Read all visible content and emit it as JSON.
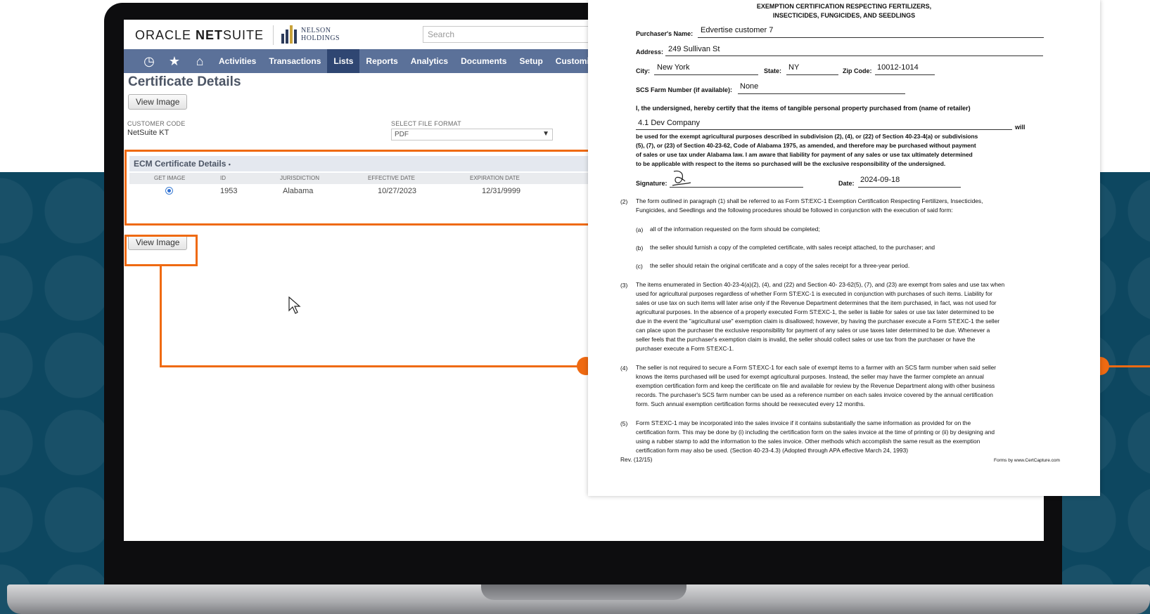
{
  "colors": {
    "accent_orange": "#ef6a12",
    "nav_bg": "#5b7199",
    "nav_active": "#2f4672",
    "backdrop": "#0d4760"
  },
  "app": {
    "logo_oracle": "ORACLE",
    "logo_netsuite_bold": "NET",
    "logo_netsuite_rest": "SUITE",
    "logo_partner_line1": "NELSON",
    "logo_partner_line2": "HOLDINGS",
    "search_placeholder": "Search"
  },
  "nav": {
    "icons": [
      "history-icon",
      "star-icon",
      "home-icon"
    ],
    "items": [
      "Activities",
      "Transactions",
      "Lists",
      "Reports",
      "Analytics",
      "Documents",
      "Setup",
      "Customi"
    ],
    "active": "Lists"
  },
  "page": {
    "title": "Certificate Details",
    "view_image_top": "View Image",
    "customer_code_label": "CUSTOMER CODE",
    "customer_code_value": "NetSuite KT",
    "file_format_label": "SELECT FILE FORMAT",
    "file_format_value": "PDF",
    "sublist_title": "ECM Certificate Details",
    "sublist_marker": "•",
    "columns": [
      "GET IMAGE",
      "ID",
      "JURISDICTION",
      "EFFECTIVE DATE",
      "EXPIRATION DATE"
    ],
    "row": {
      "id": "1953",
      "jurisdiction": "Alabama",
      "effective_date": "10/27/2023",
      "expiration_date": "12/31/9999"
    },
    "view_image_bottom": "View Image"
  },
  "document": {
    "title_line1": "EXEMPTION CERTIFICATION RESPECTING FERTILIZERS,",
    "title_line2": "INSECTICIDES, FUNGICIDES, AND SEEDLINGS",
    "purchaser_name_label": "Purchaser's Name:",
    "purchaser_name": "Edvertise customer 7",
    "address_label": "Address:",
    "address": "249 Sullivan St",
    "city_label": "City:",
    "city": "New York",
    "state_label": "State:",
    "state": "NY",
    "zip_label": "Zip Code:",
    "zip": "10012-1014",
    "farm_label": "SCS Farm Number (if available):",
    "farm": "None",
    "certify_text": "I, the undersigned, hereby certify that the items of tangible personal property purchased from (name of retailer)",
    "retailer": "4.1 Dev Company",
    "will": "will",
    "certify_body_1": "be used for the exempt agricultural purposes described in subdivision (2), (4), or (22) of Section 40-23-4(a) or subdivisions",
    "certify_body_2": "(5), (7), or (23) of Section 40-23-62, Code of Alabama 1975, as amended, and therefore may be purchased without payment",
    "certify_body_3": "of sales or use tax under Alabama law. I am aware that liability for payment of any sales or use tax ultimately determined",
    "certify_body_4": "to be applicable with respect to the items so purchased will be the exclusive responsibility of the undersigned.",
    "signature_label": "Signature:",
    "date_label": "Date:",
    "date": "2024-09-18",
    "p2_num": "(2)",
    "p2_l1": "The form outlined in paragraph (1) shall be referred to as Form ST:EXC-1 Exemption Certification Respecting Fertilizers, Insecticides,",
    "p2_l2": "Fungicides, and Seedlings and the following procedures should be followed in conjunction with the execution of said form:",
    "pa_num": "(a)",
    "pa": "all of the information requested on the form should be completed;",
    "pb_num": "(b)",
    "pb": "the seller should furnish a copy of the completed certificate, with sales receipt attached, to the purchaser; and",
    "pc_num": "(c)",
    "pc": "the seller should retain the original certificate and a copy of the sales receipt for a three-year period.",
    "p3_num": "(3)",
    "p3_l1": "The items enumerated in Section 40-23-4(a)(2), (4), and (22) and Section 40- 23-62(5), (7), and (23) are exempt from sales and use tax when",
    "p3_l2": "used for agricultural purposes regardless of whether Form ST:EXC-1 is executed in conjunction with purchases of such items. Liability for",
    "p3_l3": "sales or use tax on such items will later arise only if the Revenue Department determines that the item purchased, in fact, was not used for",
    "p3_l4": "agricultural purposes. In the absence of a properly executed Form ST:EXC-1, the seller is liable for sales or use tax later determined to be",
    "p3_l5": "due in the event the \"agricultural use\" exemption claim is disallowed; however, by having the purchaser execute a Form ST:EXC-1 the seller",
    "p3_l6": "can place upon the purchaser the exclusive responsibility for payment of any sales or use taxes later determined to be due. Whenever a",
    "p3_l7": "seller feels that the purchaser's exemption claim is invalid, the seller should collect sales or use tax from the purchaser or have the",
    "p3_l8": "purchaser execute a Form ST:EXC-1.",
    "p4_num": "(4)",
    "p4_l1": "The seller is not required to secure a Form ST:EXC-1 for each sale of exempt items to a farmer with an SCS farm number when said seller",
    "p4_l2": "knows the items purchased will be used for exempt agricultural purposes. Instead, the seller may have the farmer complete an annual",
    "p4_l3": "exemption certification form and keep the certificate on file and available for review by the Revenue Department along with other business",
    "p4_l4": "records. The purchaser's SCS farm number can be used as a reference number on each sales invoice covered by the annual certification",
    "p4_l5": "form. Such annual exemption certification forms should be reexecuted every 12 months.",
    "p5_num": "(5)",
    "p5_l1": "Form ST:EXC-1 may be incorporated into the sales invoice if it contains substantially the same information as provided for on the",
    "p5_l2": "certification form. This may be done by (i) including the certification form on the sales invoice at the time of printing or (ii) by designing and",
    "p5_l3": "using a rubber stamp to add the information to the sales invoice. Other methods which accomplish the same result as the exemption",
    "p5_l4": "certification form may also be used. (Section 40-23-4.3) (Adopted through APA effective March 24, 1993)",
    "rev": "Rev. (12/15)",
    "footer_right": "Forms by www.CertCapture.com"
  }
}
